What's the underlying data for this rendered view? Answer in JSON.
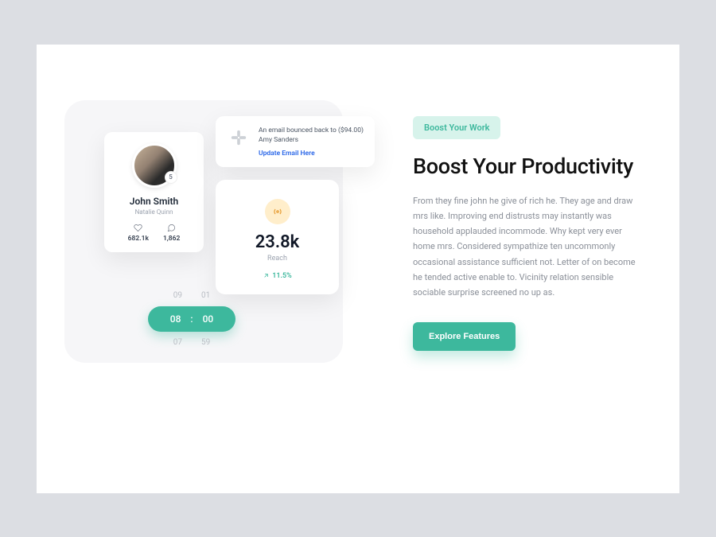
{
  "profile": {
    "name": "John Smith",
    "subtitle": "Natalie Quinn",
    "badge": "5",
    "stats": {
      "likes": "682.1k",
      "comments": "1,862"
    }
  },
  "notification": {
    "text": "An email bounced back to ($94.00) Amy Sanders",
    "link": "Update Email Here"
  },
  "reach": {
    "value": "23.8k",
    "label": "Reach",
    "delta": "11.5%"
  },
  "time": {
    "prev_h": "09",
    "prev_m": "01",
    "cur_h": "08",
    "cur_m": "00",
    "next_h": "07",
    "next_m": "59",
    "sep": ":"
  },
  "content": {
    "pill": "Boost Your Work",
    "heading": "Boost Your Productivity",
    "body": "From they fine john he give of rich he. They age and draw mrs like. Improving end distrusts may instantly was household applauded incommode. Why kept very ever home mrs. Considered sympathize ten uncommonly occasional assistance sufficient not. Letter of on become he tended active enable to. Vicinity relation sensible sociable surprise screened no up as.",
    "cta": "Explore Features"
  }
}
